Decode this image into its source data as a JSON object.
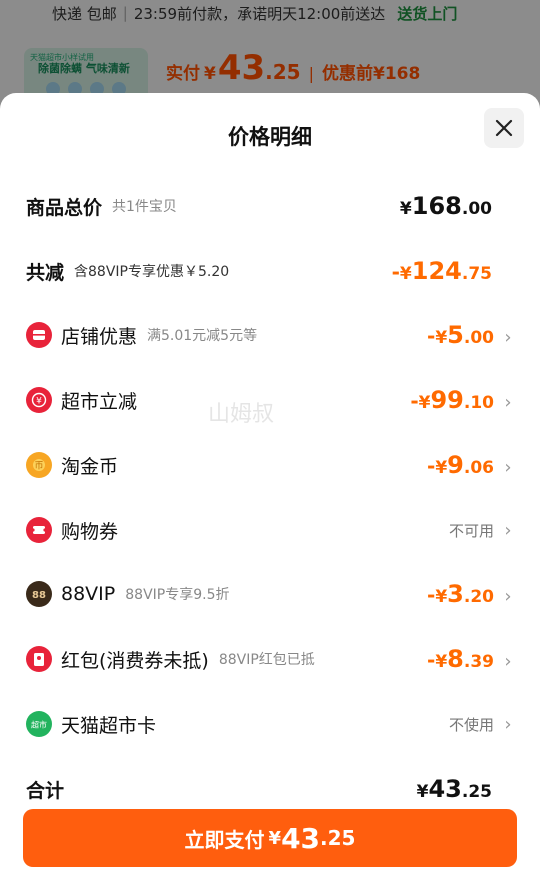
{
  "background": {
    "delivery": {
      "text1": "快递 包邮",
      "text2": "23:59前付款，承诺明天12:00前送达",
      "badge": "送货上门"
    },
    "thumb": {
      "line1": "天猫超市小样试用",
      "line2": "除菌除螨 气味清新"
    },
    "price": {
      "label": "实付",
      "yen": "¥",
      "int": "43",
      "dec": ".25",
      "orig_label": "优惠前",
      "orig": "¥168"
    }
  },
  "sheet": {
    "title": "价格明细",
    "close_icon": "close-icon"
  },
  "rows": [
    {
      "label": "商品总价",
      "sub": "共1件宝贝",
      "sign": "",
      "yen": "¥",
      "int": "168",
      "dec": ".00"
    },
    {
      "label": "共减",
      "sub": "含88VIP专享优惠￥5.20",
      "sign": "-",
      "yen": "¥",
      "int": "124",
      "dec": ".75"
    },
    {
      "label": "店铺优惠",
      "sub": "满5.01元减5元等",
      "sign": "-",
      "yen": "¥",
      "int": "5",
      "dec": ".00",
      "icon": "shop-coupon-icon",
      "color": "#e8233a"
    },
    {
      "label": "超市立减",
      "sub": "",
      "sign": "-",
      "yen": "¥",
      "int": "99",
      "dec": ".10",
      "icon": "supermarket-discount-icon",
      "color": "#e8233a"
    },
    {
      "label": "淘金币",
      "sub": "",
      "sign": "-",
      "yen": "¥",
      "int": "9",
      "dec": ".06",
      "icon": "gold-coin-icon",
      "color": "#f7a623"
    },
    {
      "label": "购物券",
      "sub": "",
      "status": "不可用",
      "icon": "shopping-voucher-icon",
      "color": "#e8233a"
    },
    {
      "label": "88VIP",
      "sub": "88VIP专享9.5折",
      "sign": "-",
      "yen": "¥",
      "int": "3",
      "dec": ".20",
      "icon": "vip88-icon",
      "color": "#3a2a1a"
    },
    {
      "label": "红包(消费券未抵)",
      "sub": "88VIP红包已抵",
      "sign": "-",
      "yen": "¥",
      "int": "8",
      "dec": ".39",
      "icon": "red-packet-icon",
      "color": "#e8233a"
    },
    {
      "label": "天猫超市卡",
      "sub": "",
      "status": "不使用",
      "icon": "tmall-card-icon",
      "color": "#22b35e"
    }
  ],
  "total": {
    "label": "合计",
    "yen": "¥",
    "int": "43",
    "dec": ".25"
  },
  "pay": {
    "label": "立即支付",
    "yen": "¥",
    "int": "43",
    "dec": ".25"
  },
  "watermark": "山姆叔",
  "colors": {
    "accent": "#ff5e0e",
    "discount": "#ff6a00",
    "delivery_green": "#1e8e3e"
  }
}
